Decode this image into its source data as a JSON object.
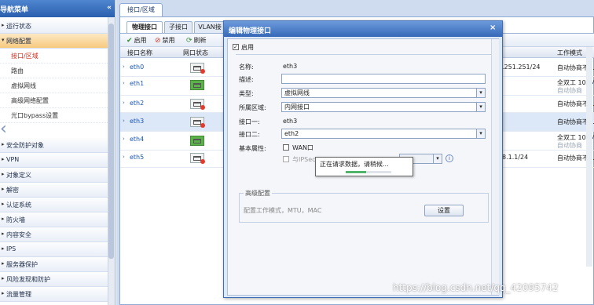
{
  "sidebar": {
    "title": "导航菜单",
    "collapse_glyph": "«",
    "items": [
      {
        "label": "运行状态"
      },
      {
        "label": "网络配置",
        "active": true
      },
      {
        "label": "安全防护对象"
      },
      {
        "label": "VPN"
      },
      {
        "label": "对象定义"
      },
      {
        "label": "解密"
      },
      {
        "label": "认证系统"
      },
      {
        "label": "防火墙"
      },
      {
        "label": "内容安全"
      },
      {
        "label": "IPS"
      },
      {
        "label": "服务器保护"
      },
      {
        "label": "风险发现和防护"
      },
      {
        "label": "流量管理"
      }
    ],
    "network_subitems": [
      {
        "label": "接口/区域",
        "active": true
      },
      {
        "label": "路由"
      },
      {
        "label": "虚拟网线"
      },
      {
        "label": "高级网络配置"
      },
      {
        "label": "光口bypass设置"
      }
    ]
  },
  "main": {
    "top_tab": "接口/区域",
    "sub_tabs": [
      "物理接口",
      "子接口",
      "VLAN接"
    ],
    "toolbar": {
      "enable": "启用",
      "disable": "禁用",
      "refresh": "刷新"
    },
    "columns": {
      "name": "接口名称",
      "status": "网口状态",
      "work_mode": "工作模式"
    },
    "rows": [
      {
        "name": "eth0",
        "link_up": false,
        "ip": ".251.251/24",
        "mode": "自动协商不..."
      },
      {
        "name": "eth1",
        "link_up": true,
        "ip": "",
        "mode": "全双工 100M",
        "mode2": "自动协商"
      },
      {
        "name": "eth2",
        "link_up": false,
        "ip": "",
        "mode": "自动协商不..."
      },
      {
        "name": "eth3",
        "link_up": false,
        "ip": "",
        "mode": "自动协商不...",
        "selected": true
      },
      {
        "name": "eth4",
        "link_up": true,
        "ip": "",
        "mode": "全双工 100M",
        "mode2": "自动协商"
      },
      {
        "name": "eth5",
        "link_up": false,
        "ip": "8.1.1/24",
        "mode": "自动协商不..."
      }
    ]
  },
  "modal": {
    "title": "编辑物理接口",
    "close": "×",
    "enable_label": "启用",
    "name_label": "名称:",
    "name_value": "eth3",
    "desc_label": "描述:",
    "desc_value": "",
    "type_label": "类型:",
    "type_value": "虚拟网线",
    "zone_label": "所属区域:",
    "zone_value": "内网接口",
    "if1_label": "接口一:",
    "if1_value": "eth3",
    "if2_label": "接口二:",
    "if2_value": "eth2",
    "basic_label": "基本属性:",
    "wan_label": "WAN口",
    "ipsec_label": "与IPSec",
    "info_glyph": "i",
    "advanced_title": "高级配置",
    "advanced_desc": "配置工作模式，MTU，MAC",
    "settings_button": "设置"
  },
  "loading": {
    "message": "正在请求数据，请稍候...",
    "progress": 0.45
  },
  "watermark": "https://blog.csdn.net/qq_42095742",
  "colors": {
    "accent": "#3668b8",
    "link_up": "#5bb24a",
    "active_menu": "#f7c97e"
  }
}
